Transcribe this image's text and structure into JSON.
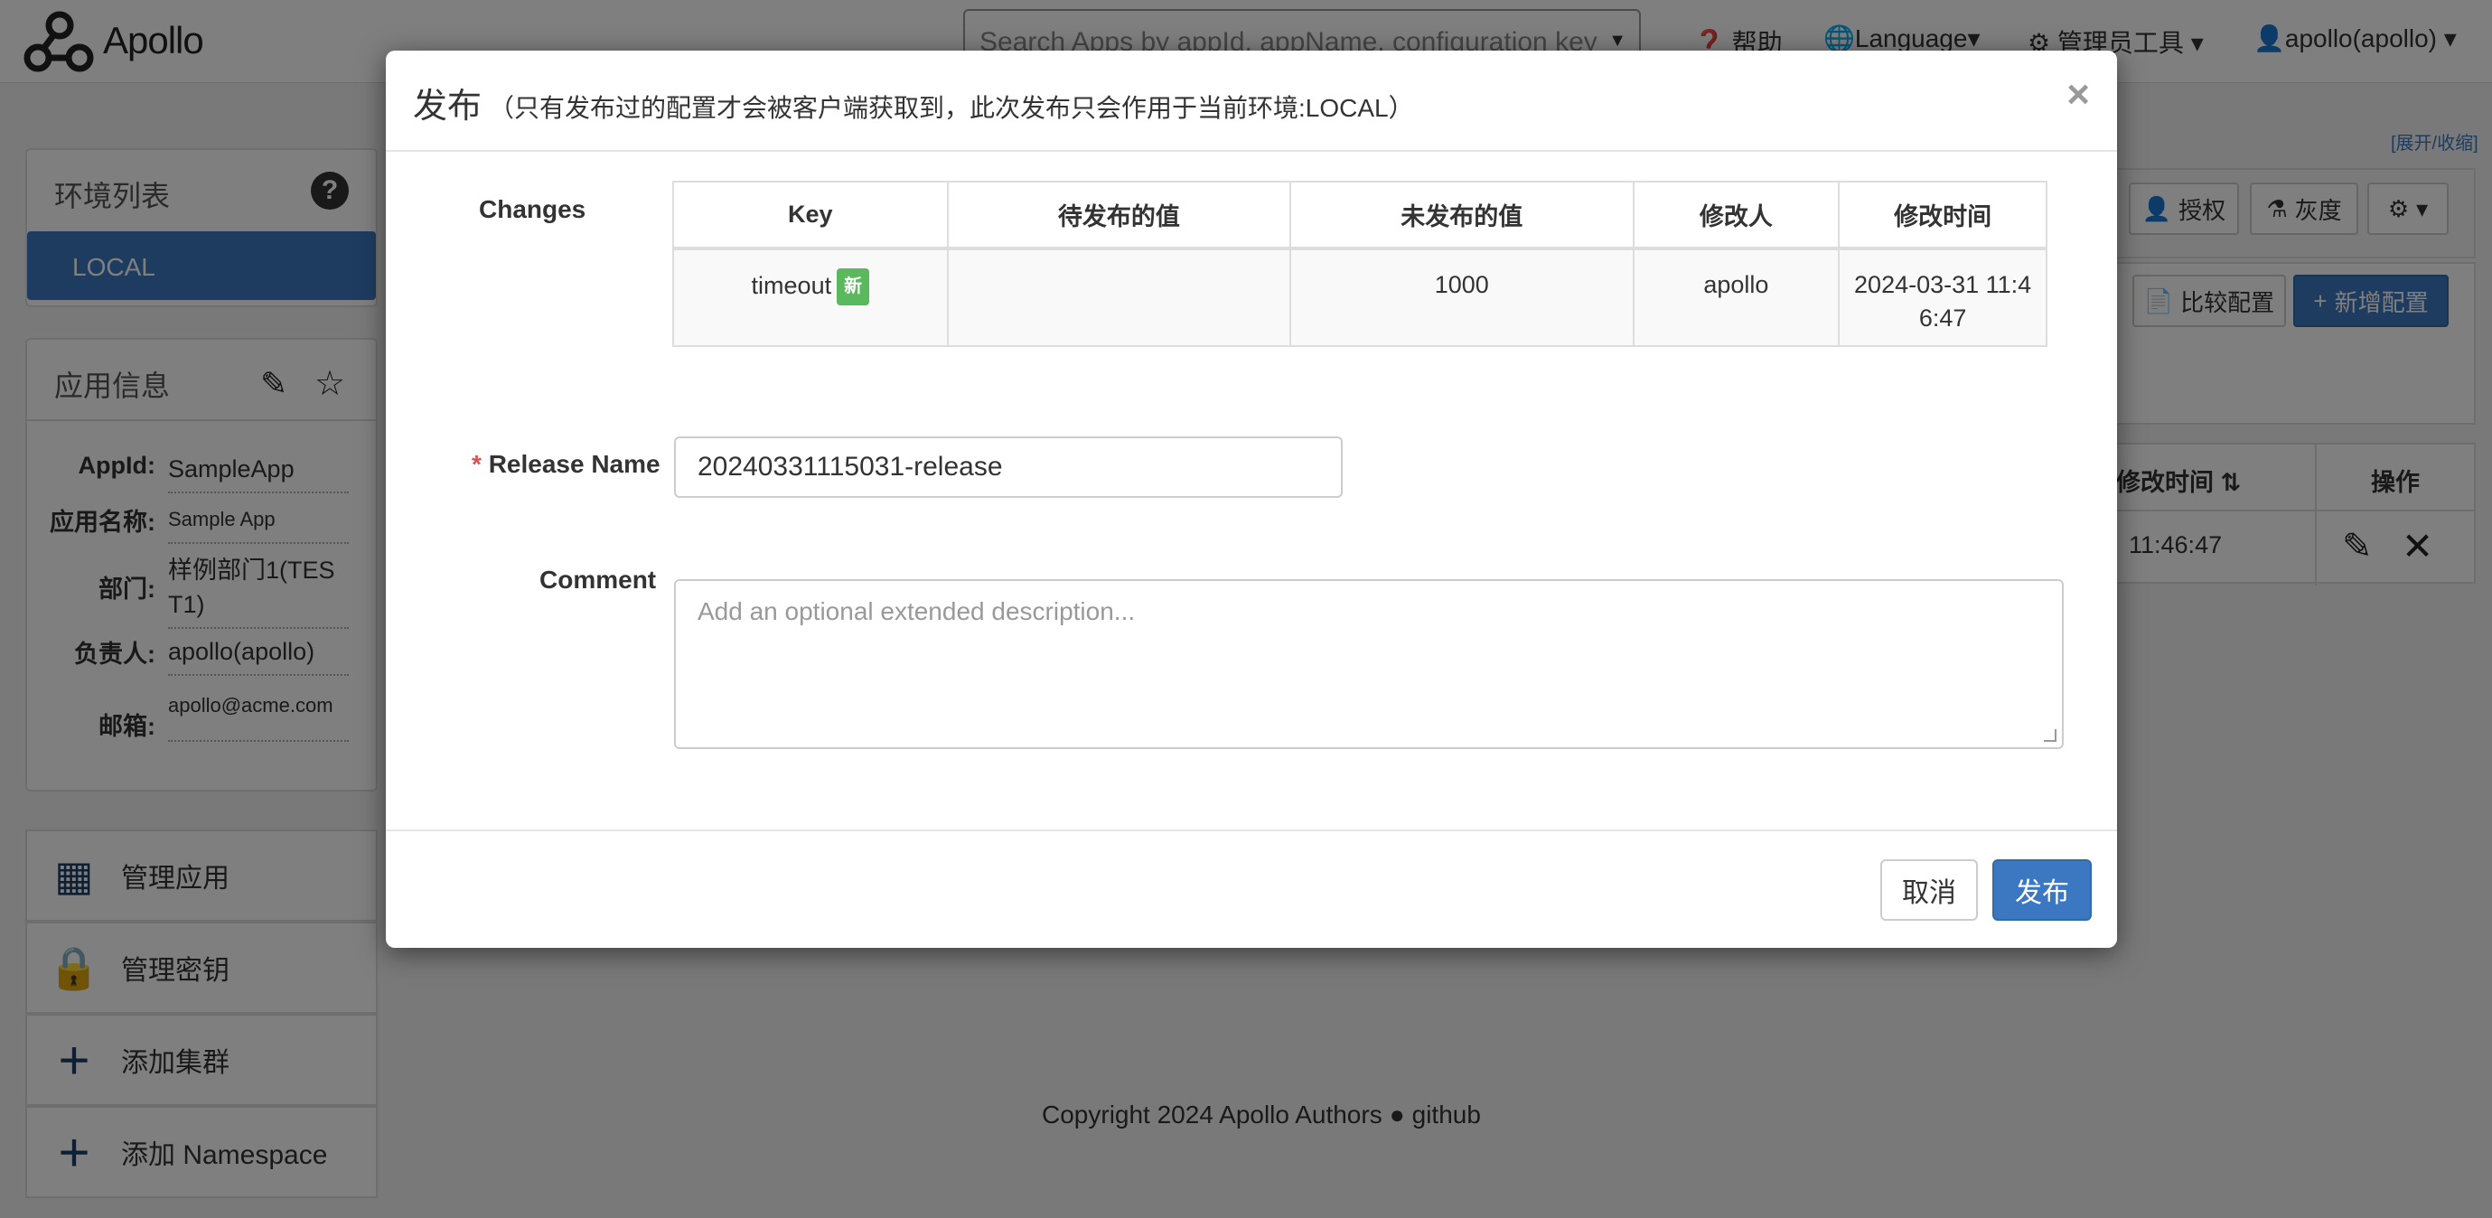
{
  "navbar": {
    "brand": "Apollo",
    "search_placeholder": "Search Apps by appId, appName, configuration key",
    "help": "帮助",
    "language": "Language",
    "admin_tools": "管理员工具",
    "user": "apollo(apollo)"
  },
  "env_panel": {
    "title": "环境列表",
    "items": [
      "LOCAL"
    ]
  },
  "app_info": {
    "title": "应用信息",
    "rows": [
      {
        "label": "AppId:",
        "value": "SampleApp"
      },
      {
        "label": "应用名称:",
        "value": "Sample App"
      },
      {
        "label": "部门:",
        "value": "样例部门1(TEST1)"
      },
      {
        "label": "负责人:",
        "value": "apollo(apollo)"
      },
      {
        "label": "邮箱:",
        "value": "apollo@acme.com"
      }
    ]
  },
  "side_menu": [
    {
      "label": "管理应用",
      "icon": "dashboard-icon"
    },
    {
      "label": "管理密钥",
      "icon": "lock-icon"
    },
    {
      "label": "添加集群",
      "icon": "plus-icon"
    },
    {
      "label": "添加 Namespace",
      "icon": "plus-icon"
    }
  ],
  "right_panel": {
    "expand_collapse": "[展开/收缩]",
    "authorize": "授权",
    "gray": "灰度",
    "compare": "比较配置",
    "add_config": "新增配置",
    "col_modified_time": "修改时间",
    "col_actions": "操作",
    "row_time": "11:46:47"
  },
  "modal": {
    "title": "发布",
    "subtitle": "（只有发布过的配置才会被客户端获取到，此次发布只会作用于当前环境:LOCAL）",
    "close": "×",
    "changes_label": "Changes",
    "columns": [
      "Key",
      "待发布的值",
      "未发布的值",
      "修改人",
      "修改时间"
    ],
    "rows": [
      {
        "key": "timeout",
        "badge": "新",
        "new_value": "",
        "old_value": "1000",
        "modifier": "apollo",
        "time": "2024-03-31 11:46:47"
      }
    ],
    "release_name_label": "Release Name",
    "release_name_required": "*",
    "release_name_value": "20240331115031-release",
    "comment_label": "Comment",
    "comment_placeholder": "Add an optional extended description...",
    "cancel": "取消",
    "publish": "发布"
  },
  "footer": {
    "copyright": "Copyright 2024 Apollo Authors",
    "github": "github"
  }
}
